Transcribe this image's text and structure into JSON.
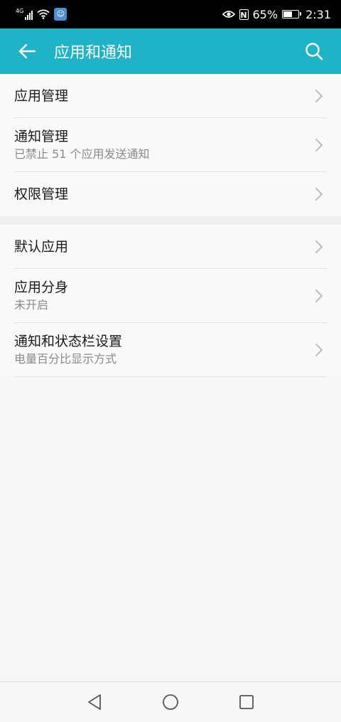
{
  "status_bar": {
    "network_type": "4G",
    "battery_percent": "65%",
    "battery_level": 0.65,
    "time": "2:31",
    "nfc_label": "N",
    "icons": [
      "signal-icon",
      "wifi-icon",
      "app-notification-icon",
      "eye-comfort-icon",
      "nfc-icon",
      "battery-icon"
    ]
  },
  "app_bar": {
    "title": "应用和通知",
    "back_icon": "back-arrow-icon",
    "search_icon": "search-icon",
    "background": "#1fb3c8"
  },
  "groups": [
    {
      "items": [
        {
          "title": "应用管理",
          "subtitle": ""
        },
        {
          "title": "通知管理",
          "subtitle": "已禁止 51 个应用发送通知"
        },
        {
          "title": "权限管理",
          "subtitle": ""
        }
      ]
    },
    {
      "items": [
        {
          "title": "默认应用",
          "subtitle": ""
        },
        {
          "title": "应用分身",
          "subtitle": "未开启"
        },
        {
          "title": "通知和状态栏设置",
          "subtitle": "电量百分比显示方式"
        }
      ]
    }
  ],
  "nav_bar": {
    "icons": [
      "nav-back-icon",
      "nav-home-icon",
      "nav-recents-icon"
    ]
  }
}
